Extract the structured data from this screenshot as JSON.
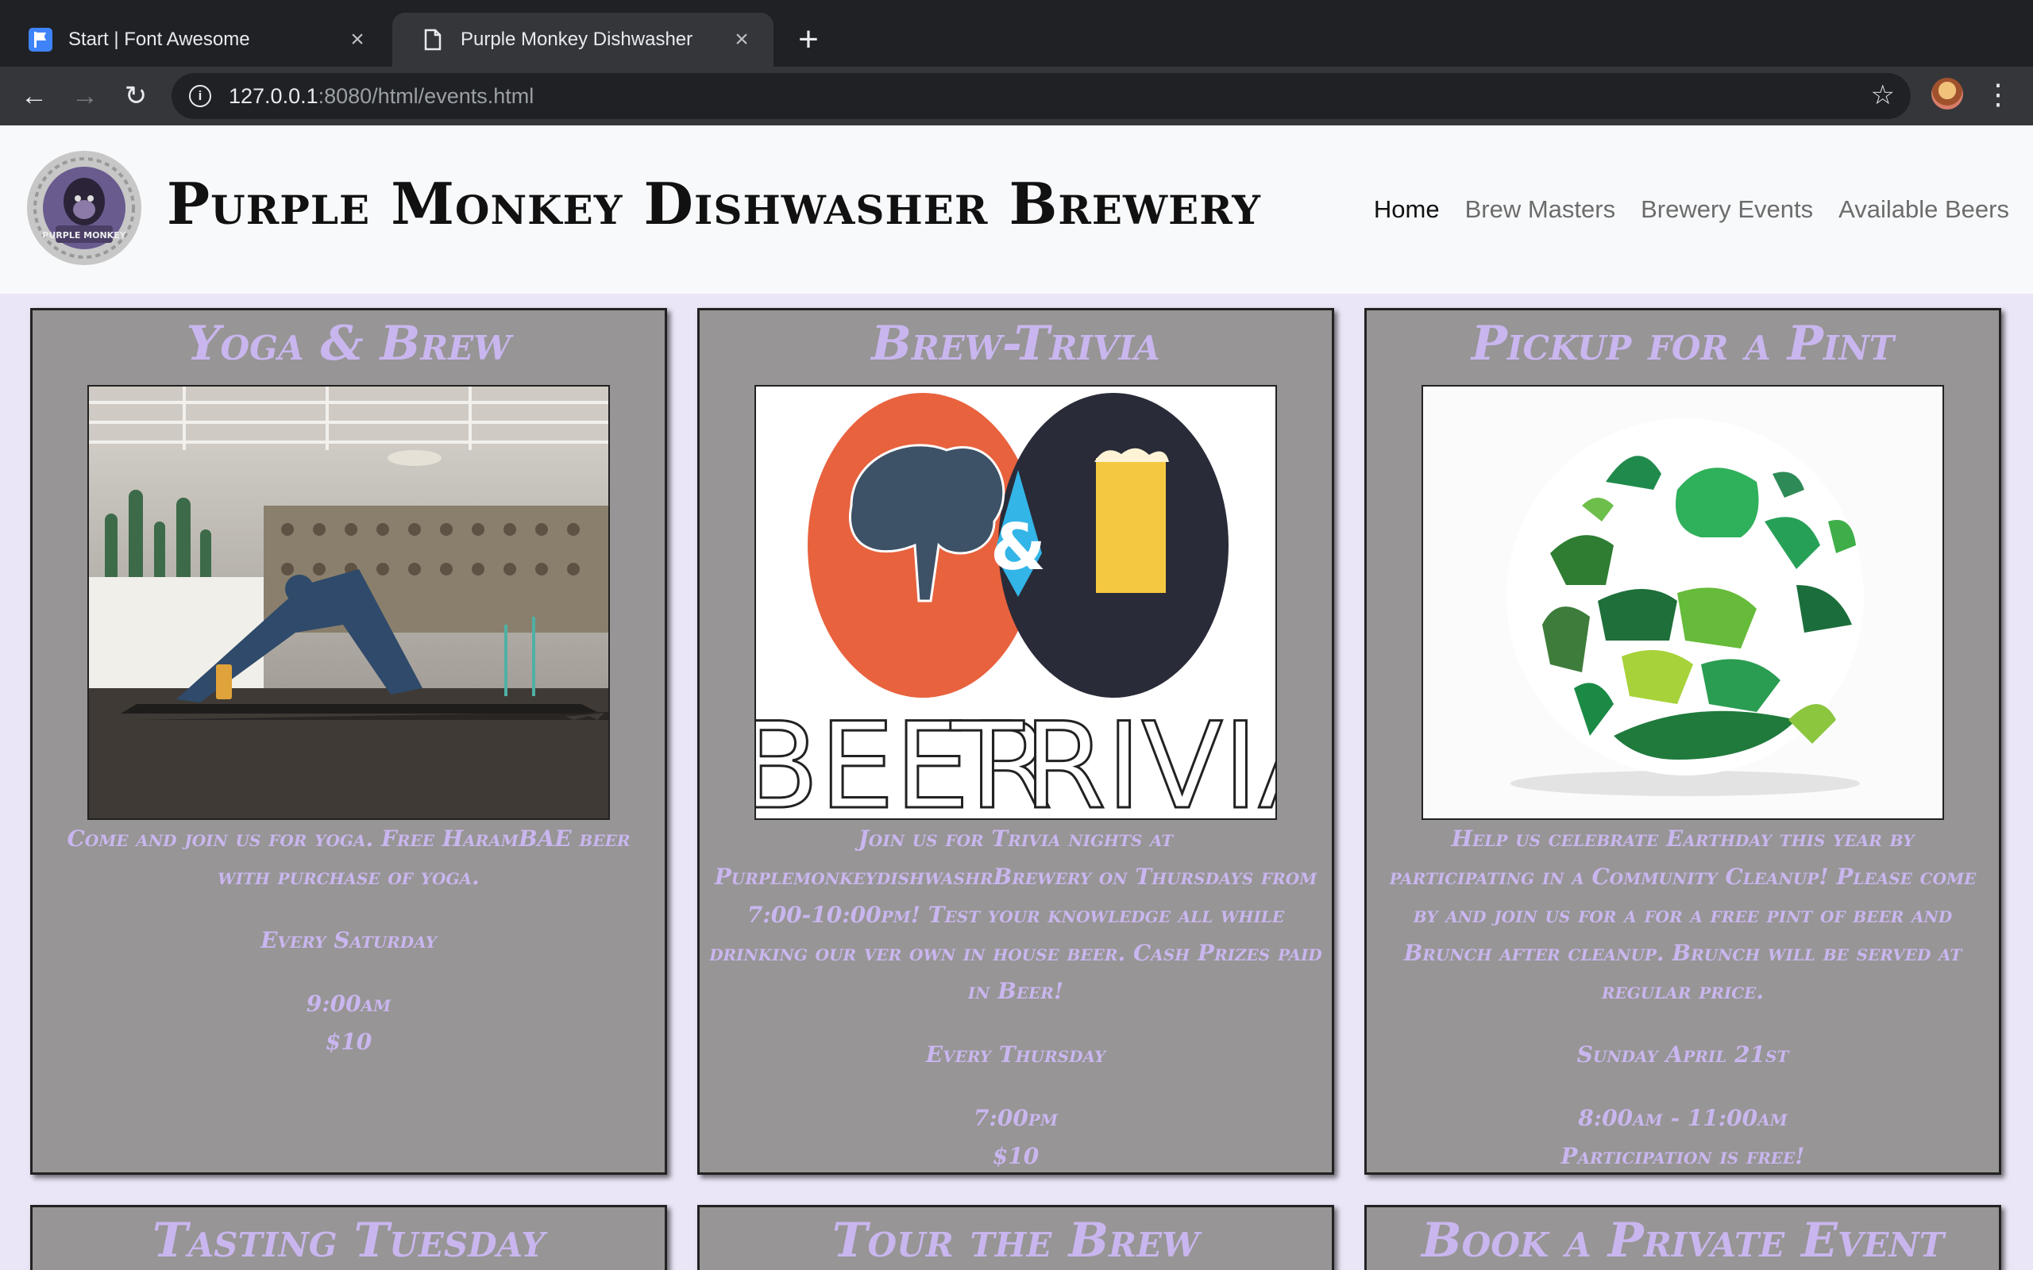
{
  "browser": {
    "tabs": [
      {
        "title": "Start | Font Awesome",
        "favicon": "font-awesome-flag-icon",
        "active": false
      },
      {
        "title": "Purple Monkey Dishwasher",
        "favicon": "page-icon",
        "active": true
      }
    ],
    "url_host": "127.0.0.1",
    "url_rest": ":8080/html/events.html"
  },
  "site": {
    "brand": "Purple Monkey Dishwasher Brewery",
    "logo_text": "PURPLE MONKEY",
    "nav": [
      "Home",
      "Brew Masters",
      "Brewery Events",
      "Available Beers"
    ]
  },
  "events": [
    {
      "title": "Yoga & Brew",
      "description": "Come and join us for yoga. Free HaramBAE beer with purchase of yoga.",
      "when": "Every Saturday",
      "time": "9:00am",
      "price": "$10"
    },
    {
      "title": "Brew-Trivia",
      "image_words": [
        "BEER",
        "&",
        "TRIVIA"
      ],
      "description": "Join us for Trivia nights at PurplemonkeydishwashrBrewery on Thursdays from 7:00-10:00pm! Test your knowledge all while drinking our ver own in house beer. Cash Prizes paid in Beer!",
      "when": "Every Thursday",
      "time": "7:00pm",
      "price": "$10"
    },
    {
      "title": "Pickup for a Pint",
      "description": "Help us celebrate Earthday this year by participating in a Community Cleanup! Please come by and join us for a for a free pint of beer and Brunch after cleanup. Brunch will be served at regular price.",
      "when": "Sunday April 21st",
      "time": "8:00am - 11:00am",
      "price": "Participation is free!"
    },
    {
      "title": "Tasting Tuesday"
    },
    {
      "title": "Tour the Brew"
    },
    {
      "title": "Book a Private Event"
    }
  ],
  "colors": {
    "accent_text": "#c9b6ef",
    "card_bg": "#979595",
    "page_bg": "#ebe6f7"
  }
}
